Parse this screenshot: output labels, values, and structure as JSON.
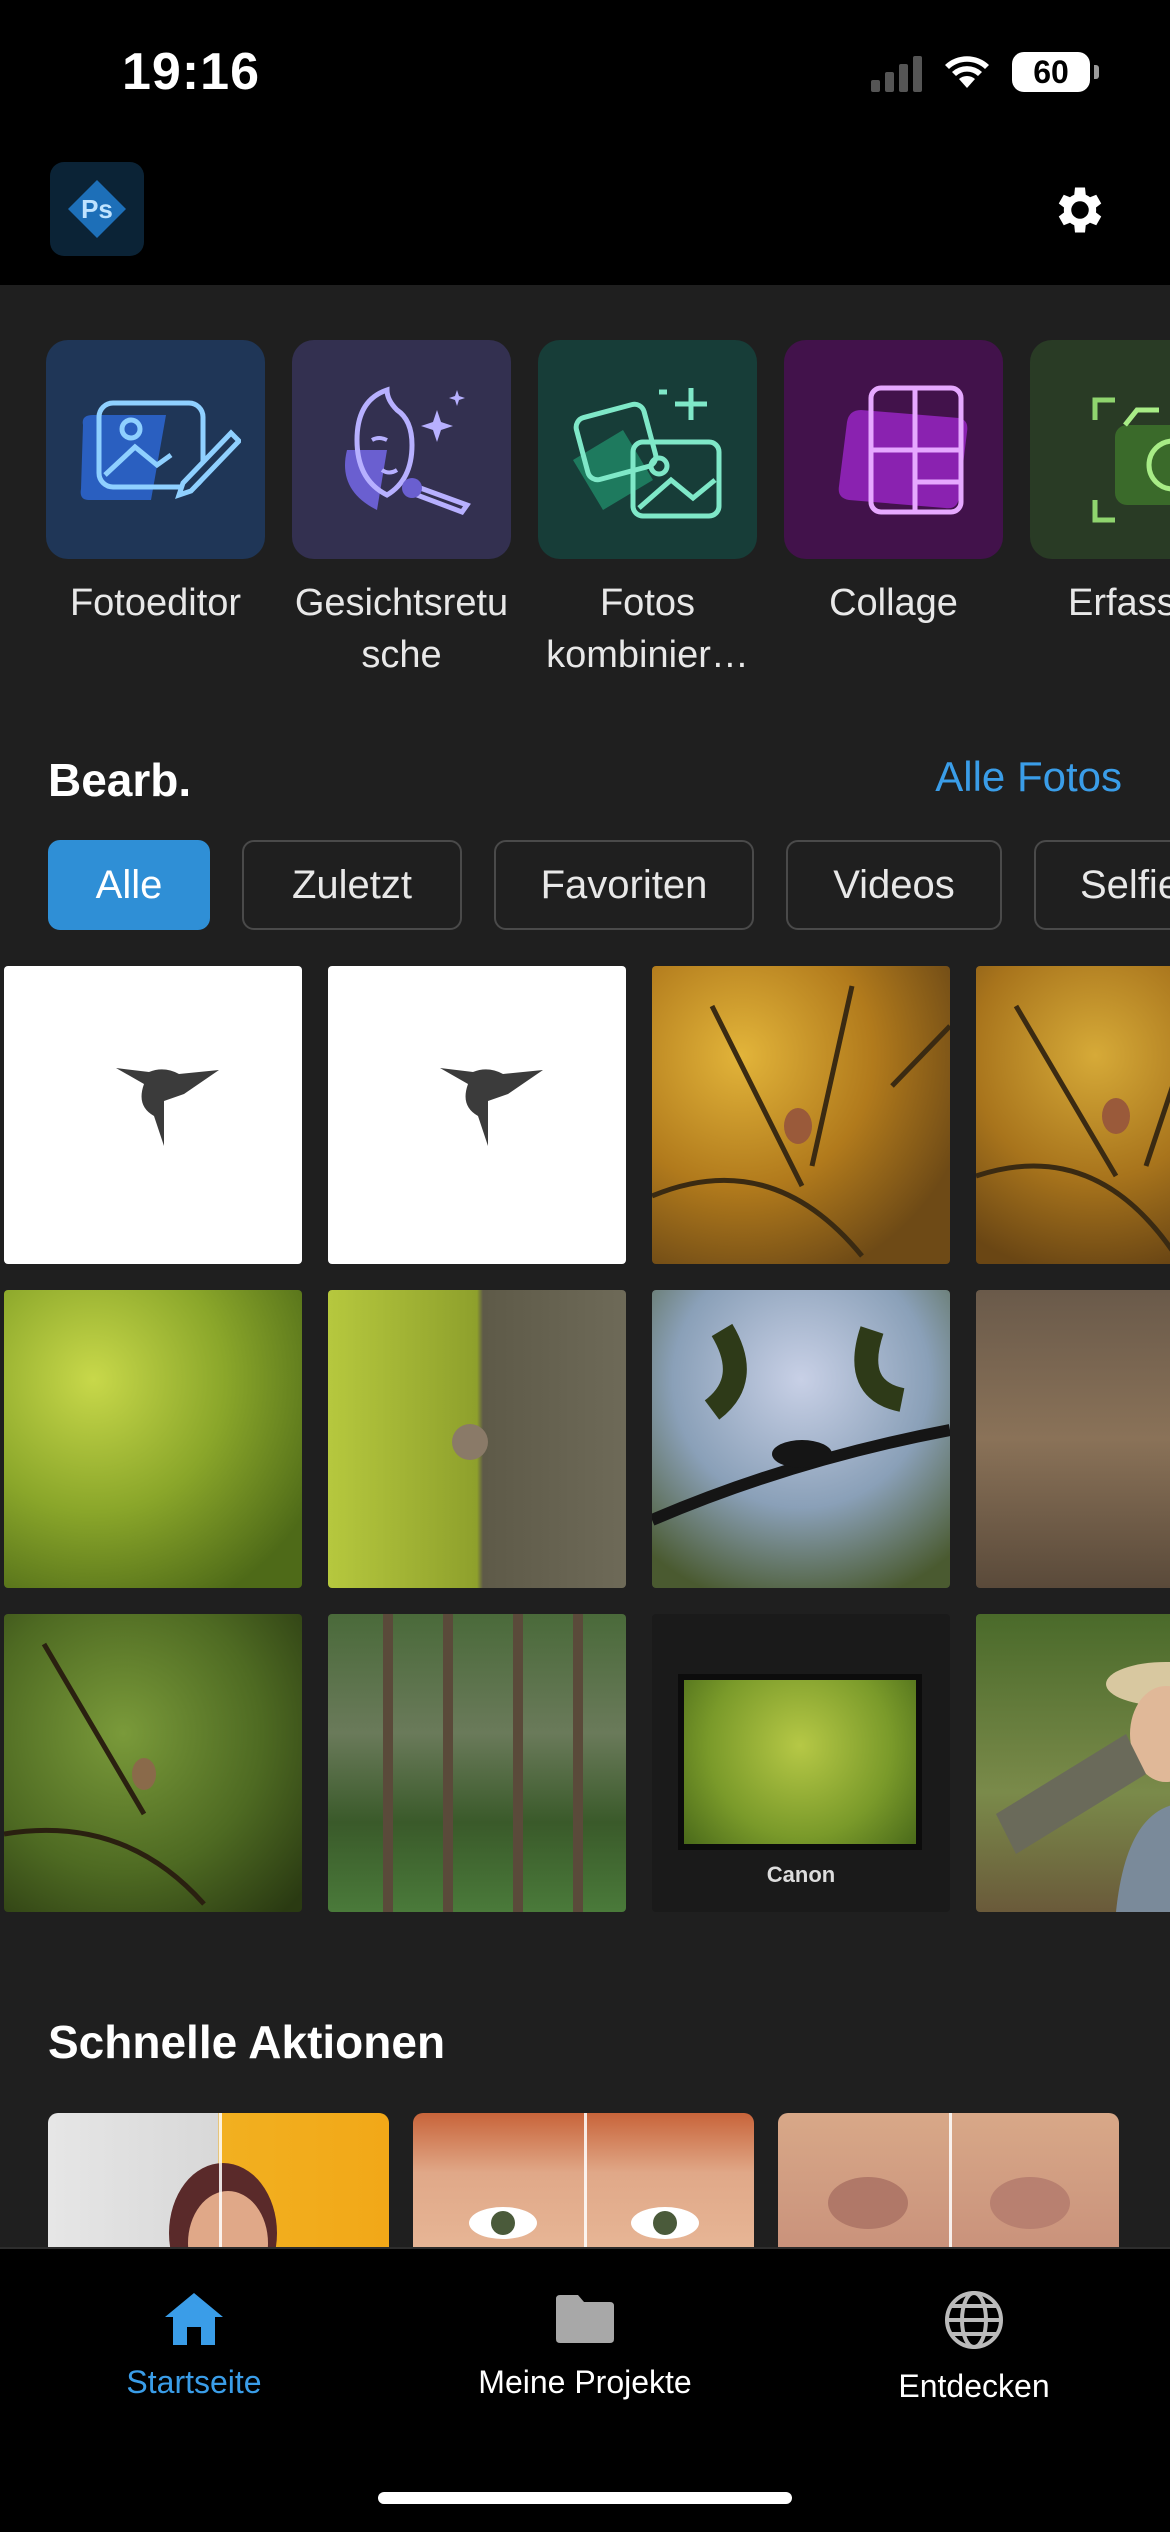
{
  "status": {
    "time": "19:16",
    "battery": "60"
  },
  "header": {
    "logo_text": "Ps"
  },
  "tools": [
    {
      "label": "Fotoeditor",
      "color": "#1f3657"
    },
    {
      "label": "Gesichtsretu\nsche",
      "color": "#333050"
    },
    {
      "label": "Fotos\nkombinier…",
      "color": "#173d38"
    },
    {
      "label": "Collage",
      "color": "#42124b"
    },
    {
      "label": "Erfass",
      "color": "#293b25"
    }
  ],
  "edit_section": {
    "title": "Bearb.",
    "all_photos_link": "Alle Fotos"
  },
  "filters": [
    "Alle",
    "Zuletzt",
    "Favoriten",
    "Videos",
    "Selfie"
  ],
  "photos": [
    "hummingbird-placeholder",
    "hummingbird-placeholder",
    "bird-on-autumn-branches",
    "bird-on-autumn-branches",
    "green-bokeh-snail",
    "snail-on-tree-trunk",
    "bird-silhouette-on-branch",
    "forest-floor",
    "bird-in-green-branches",
    "forest-trees",
    "camera-screen-canon",
    "photographer-with-lens"
  ],
  "camera_brand": "Canon",
  "quick_actions": {
    "title": "Schnelle Aktionen"
  },
  "nav": [
    {
      "label": "Startseite",
      "icon": "home-icon",
      "active": true
    },
    {
      "label": "Meine Projekte",
      "icon": "folder-icon",
      "active": false
    },
    {
      "label": "Entdecken",
      "icon": "globe-icon",
      "active": false
    }
  ],
  "colors": {
    "accent": "#2f8fd6",
    "background": "#1f1f1f"
  }
}
